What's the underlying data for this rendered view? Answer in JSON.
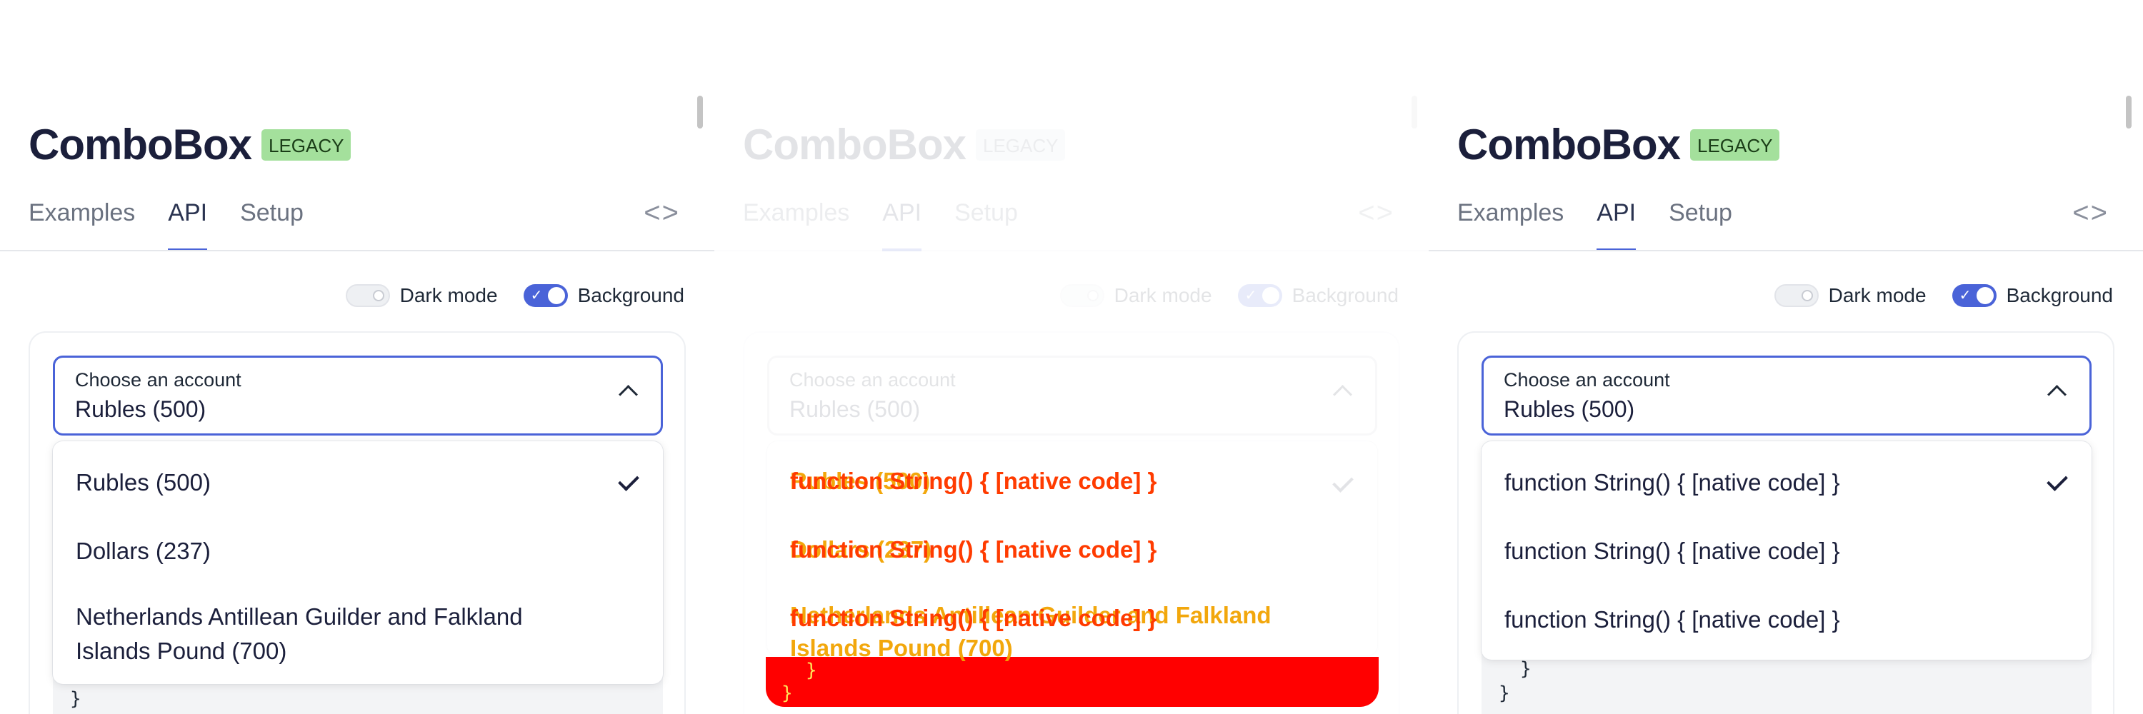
{
  "colors": {
    "accent": "#4a63d8",
    "badge_bg": "#a4e09c",
    "glitch_red": "#ff0000"
  },
  "panels": [
    {
      "title": "ComboBox",
      "badge": "LEGACY",
      "tabs": [
        "Examples",
        "API",
        "Setup"
      ],
      "active_tab": "API",
      "code_toggle": "<>",
      "dark_mode_label": "Dark mode",
      "dark_mode": false,
      "background_label": "Background",
      "background": true,
      "combo_label": "Choose an account",
      "combo_value": "Rubles (500)",
      "options": [
        "Rubles (500)",
        "Dollars (237)",
        "Netherlands Antillean Guilder and Falkland",
        "Islands Pound (700)"
      ],
      "code_line": "}"
    },
    {
      "title": "ComboBox",
      "badge": "LEGACY",
      "tabs": [
        "Examples",
        "API",
        "Setup"
      ],
      "code_toggle": "<>",
      "dark_mode_label": "Dark mode",
      "background_label": "Background",
      "combo_label": "Choose an account",
      "combo_value": "Rubles (500)",
      "layer_a": [
        "Rubles (500)",
        "Dollars (237)",
        "Netherlands Antillean Guilder and Falkland",
        "Islands Pound (700)"
      ],
      "layer_b": [
        "function String() { [native code] }",
        "function String() { [native code] }",
        "function String() { [native code] }"
      ],
      "code_lines": [
        "}",
        "}"
      ]
    },
    {
      "title": "ComboBox",
      "badge": "LEGACY",
      "tabs": [
        "Examples",
        "API",
        "Setup"
      ],
      "active_tab": "API",
      "code_toggle": "<>",
      "dark_mode_label": "Dark mode",
      "dark_mode": false,
      "background_label": "Background",
      "background": true,
      "combo_label": "Choose an account",
      "combo_value": "Rubles (500)",
      "options": [
        "function String() { [native code] }",
        "function String() { [native code] }",
        "function String() { [native code] }"
      ],
      "code_lines": [
        "}",
        "}"
      ]
    }
  ]
}
